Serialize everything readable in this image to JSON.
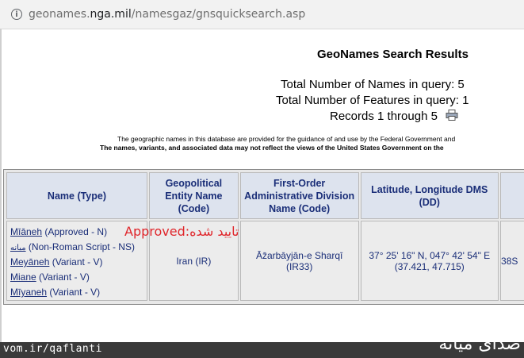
{
  "browser": {
    "url_host": "geonames.",
    "url_domain": "nga.mil",
    "url_path": "/namesgaz/gnsquicksearch.asp"
  },
  "page": {
    "title": "GeoNames Search Results",
    "total_names": "Total Number of Names in query: 5",
    "total_features": "Total Number of Features in query: 1",
    "records": "Records 1 through 5",
    "disclaimer_1": "The geographic names in this database are provided for the guidance of and use by the Federal Government and",
    "disclaimer_2": "The names, variants, and associated data may not reflect the views of the United States Government on the"
  },
  "table": {
    "headers": {
      "name_type": "Name (Type)",
      "geopolitical_1": "Geopolitical",
      "geopolitical_2": "Entity Name",
      "geopolitical_3": "(Code)",
      "adm1_1": "First-Order",
      "adm1_2": "Administrative Division",
      "adm1_3": "Name (Code)",
      "latlon_1": "Latitude, Longitude DMS",
      "latlon_2": "(DD)"
    },
    "names": [
      {
        "name": "Mīāneh",
        "type": "(Approved - N)"
      },
      {
        "name": "میانه",
        "type": "(Non-Roman Script - NS)"
      },
      {
        "name": "Meyāneh",
        "type": "(Variant - V)"
      },
      {
        "name": "Miane",
        "type": "(Variant - V)"
      },
      {
        "name": "Mīyaneh",
        "type": "(Variant - V)"
      }
    ],
    "approved_note": "Approved:تایید شده",
    "country": "Iran (IR)",
    "adm1_name": "Āz̄arbāyjān-e Sharqī",
    "adm1_code": "(IR33)",
    "dms": "37° 25' 16\" N, 047° 42' 54\" E",
    "dd": "(37.421, 47.715)",
    "cut_cell": "38S"
  },
  "footer": {
    "handle": "vom.ir/qaflanti",
    "logo": "صدای میانه"
  },
  "colors": {
    "link": "#1a2e78",
    "header_bg": "#dde3ee",
    "note_red": "#e0262b"
  },
  "icons": [
    "info-icon",
    "print-icon"
  ]
}
